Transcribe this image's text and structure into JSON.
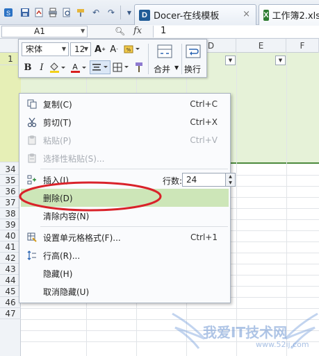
{
  "titlebar": {
    "tabs": [
      {
        "icon_letter": "D",
        "icon_color": "#1f5b96",
        "title": "Docer-在线模板"
      },
      {
        "icon_letter": "X",
        "icon_color": "#2f7d32",
        "title": "工作簿2.xls"
      }
    ],
    "close_glyph": "×"
  },
  "formula_bar": {
    "cell_ref": "A1",
    "fx_label": "fx",
    "value": "1"
  },
  "columns": [
    "D",
    "E",
    "F"
  ],
  "rows": {
    "header_row_label": "1",
    "visible_labels": [
      "34",
      "35",
      "36",
      "37",
      "38",
      "39",
      "40",
      "41",
      "42",
      "43",
      "44",
      "45",
      "46",
      "47"
    ]
  },
  "mini_toolbar": {
    "font_name": "宋体",
    "font_size": "12",
    "merge_label": "合并",
    "wrap_label": "换行"
  },
  "context_menu": {
    "items": [
      {
        "label": "复制(C)",
        "shortcut": "Ctrl+C",
        "icon": "copy-icon"
      },
      {
        "label": "剪切(T)",
        "shortcut": "Ctrl+X",
        "icon": "scissors-icon"
      },
      {
        "label": "粘贴(P)",
        "shortcut": "Ctrl+V",
        "icon": "paste-icon",
        "disabled": true
      },
      {
        "label": "选择性粘贴(S)...",
        "shortcut": "",
        "icon": "paste-special-icon",
        "disabled": true
      },
      {
        "label": "插入(I)",
        "shortcut": "",
        "icon": "insert-rows-icon"
      },
      {
        "label": "删除(D)",
        "shortcut": "",
        "icon": "",
        "highlighted": true
      },
      {
        "label": "清除内容(N)",
        "shortcut": "",
        "icon": ""
      },
      {
        "label": "设置单元格格式(F)...",
        "shortcut": "Ctrl+1",
        "icon": "format-cells-icon"
      },
      {
        "label": "行高(R)...",
        "shortcut": "",
        "icon": "row-height-icon"
      },
      {
        "label": "隐藏(H)",
        "shortcut": "",
        "icon": ""
      },
      {
        "label": "取消隐藏(U)",
        "shortcut": "",
        "icon": ""
      }
    ],
    "rows_count_label": "行数:",
    "rows_count_value": "24"
  },
  "watermark": {
    "text": "我爱IT技术网",
    "url": "www.52ij.com"
  },
  "colors": {
    "band": "#e6f2d8",
    "highlight": "#cde6b8",
    "annotation": "#d9222a"
  }
}
